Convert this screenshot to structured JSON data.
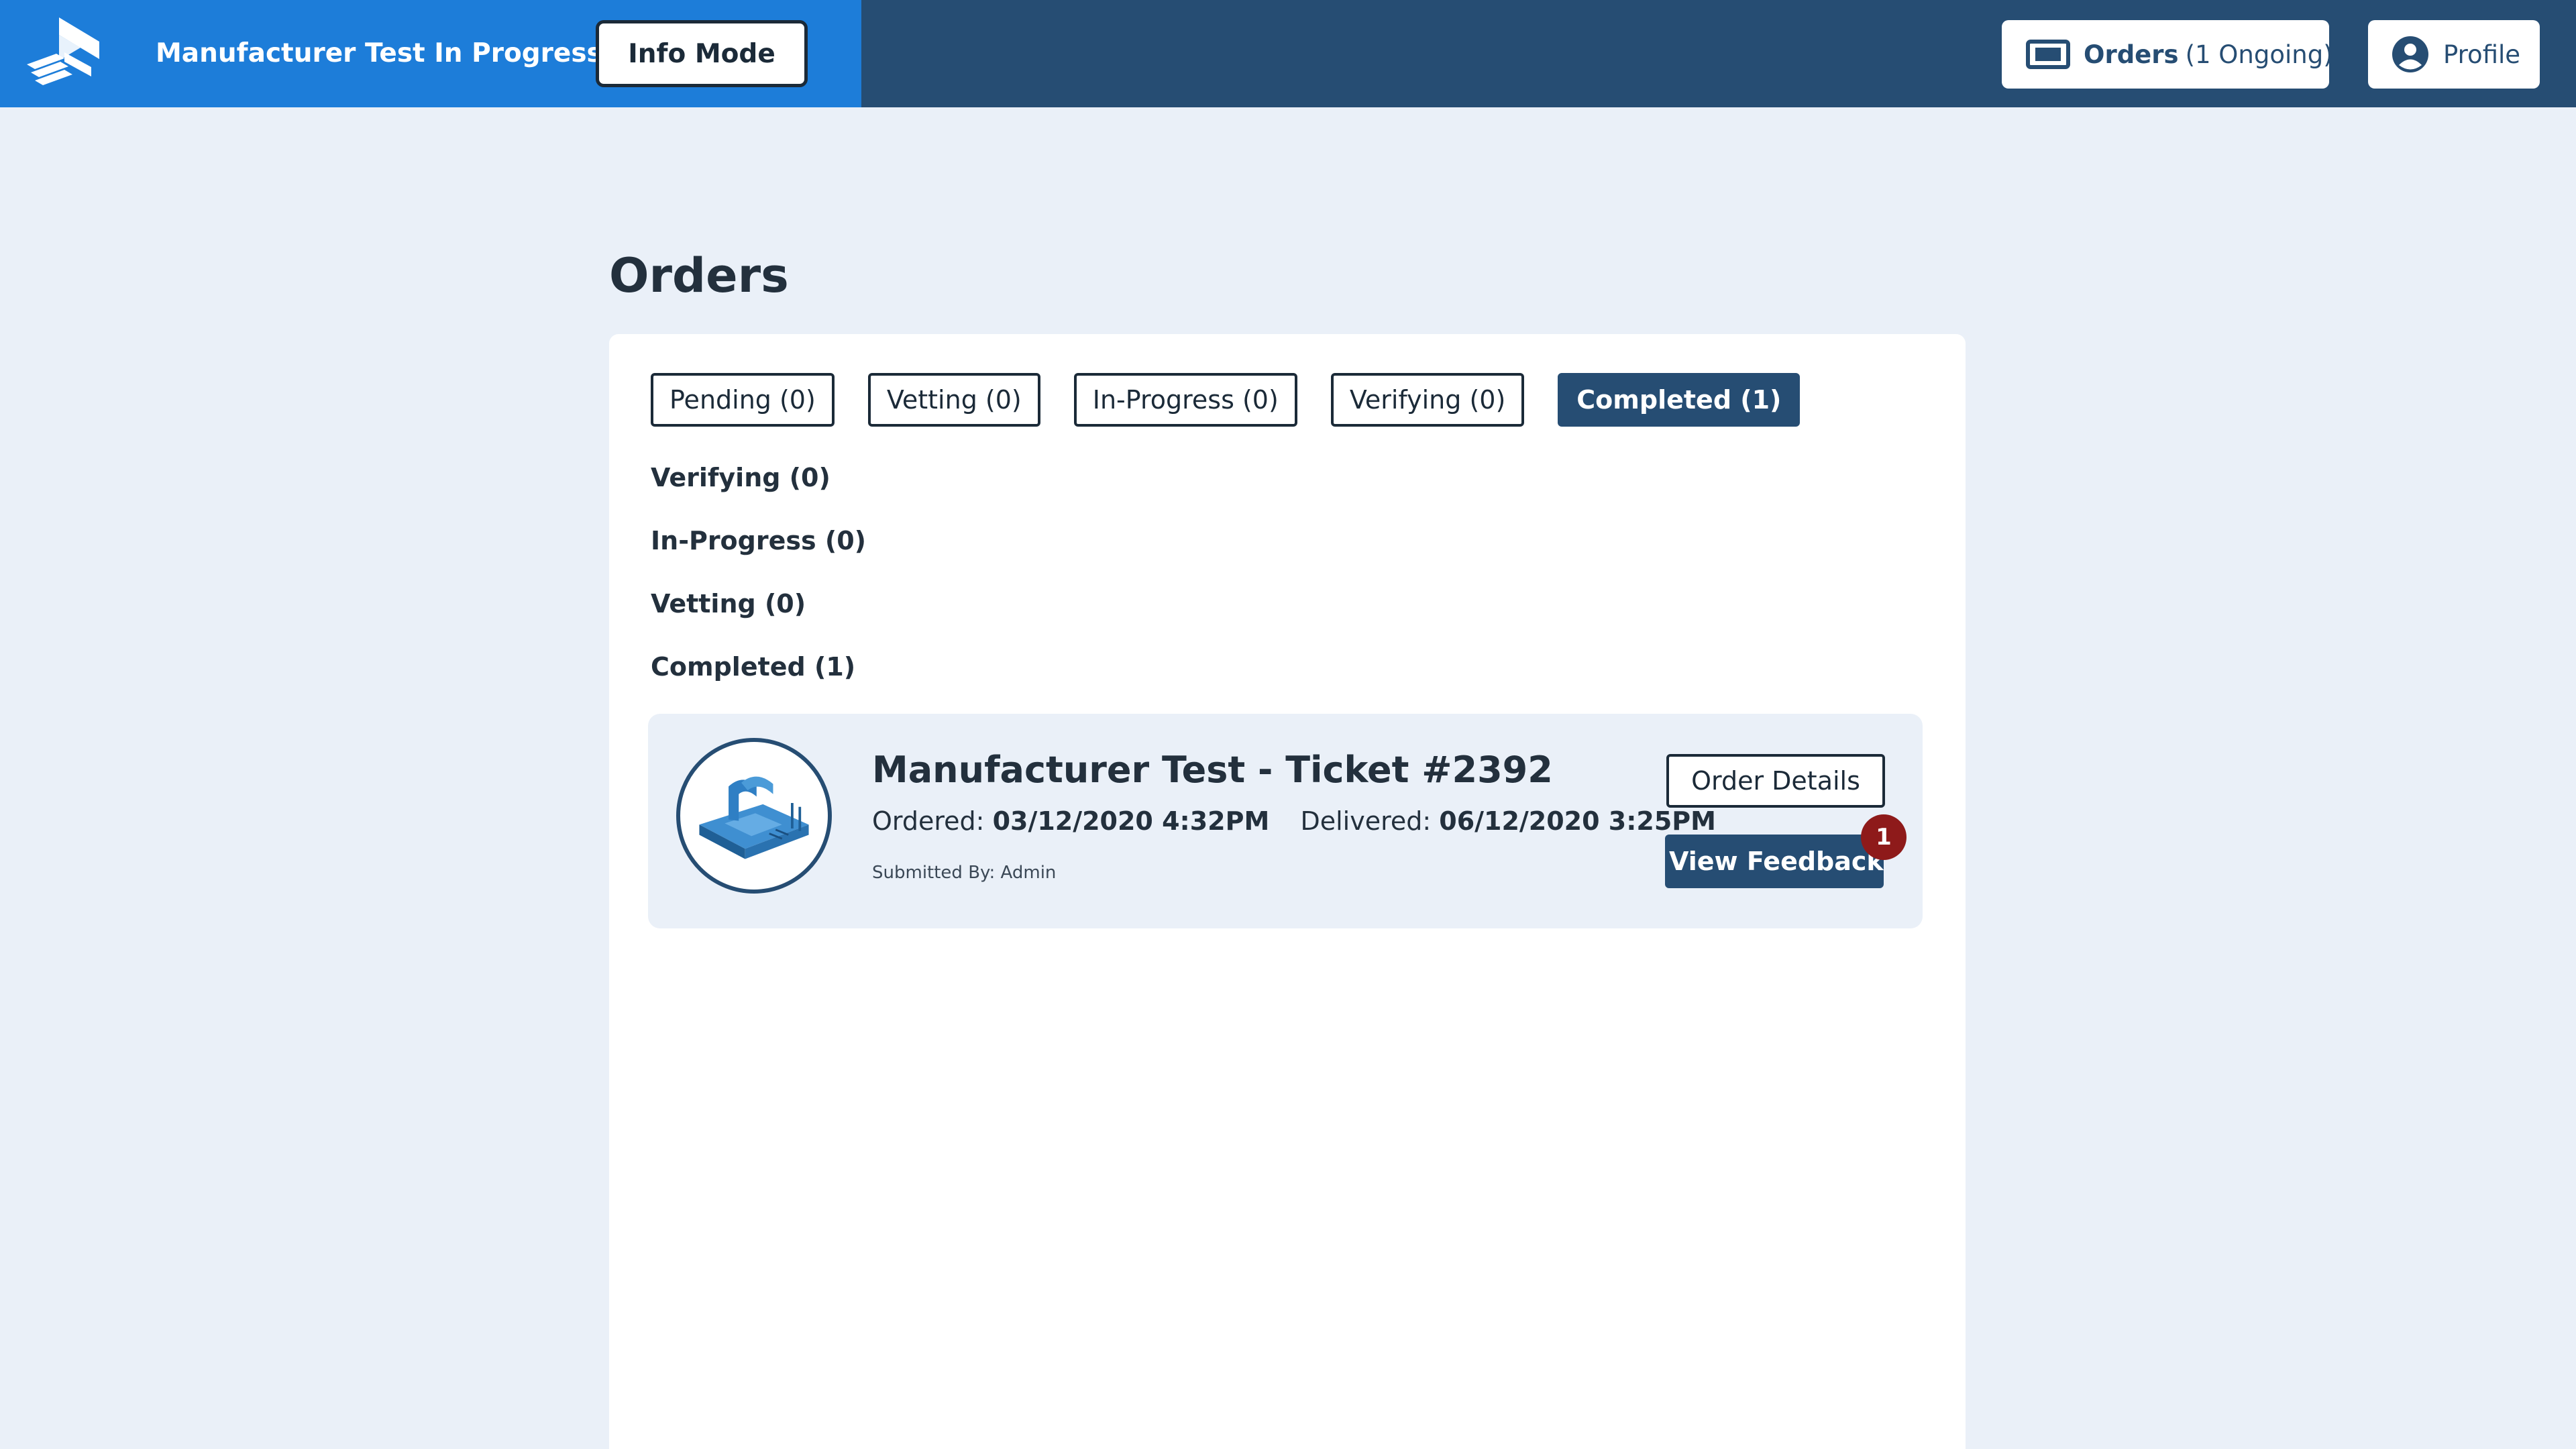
{
  "header": {
    "app_title": "Manufacturer Test In Progress",
    "info_mode_label": "Info Mode",
    "orders_label": "Orders",
    "orders_ongoing": "(1 Ongoing)",
    "profile_label": "Profile",
    "icons": [
      "logo-icon",
      "orders-icon",
      "profile-icon"
    ],
    "colors": {
      "bar": "#264d73",
      "title_area": "#1d7dd9"
    }
  },
  "page": {
    "title": "Orders"
  },
  "tabs": [
    {
      "label": "Pending (0)",
      "active": false
    },
    {
      "label": "Vetting (0)",
      "active": false
    },
    {
      "label": "In-Progress (0)",
      "active": false
    },
    {
      "label": "Verifying (0)",
      "active": false
    },
    {
      "label": "Completed (1)",
      "active": true
    }
  ],
  "sections": [
    {
      "heading": "Verifying (0)"
    },
    {
      "heading": "In-Progress (0)"
    },
    {
      "heading": "Vetting (0)"
    },
    {
      "heading": "Completed (1)"
    }
  ],
  "order": {
    "title": "Manufacturer Test - Ticket #2392",
    "ordered_label": "Ordered:",
    "ordered_value": "03/12/2020 4:32PM",
    "delivered_label": "Delivered:",
    "delivered_value": "06/12/2020 3:25PM",
    "submitted_by": "Submitted By: Admin",
    "order_details_label": "Order Details",
    "view_feedback_label": "View Feedback",
    "feedback_count": "1"
  }
}
